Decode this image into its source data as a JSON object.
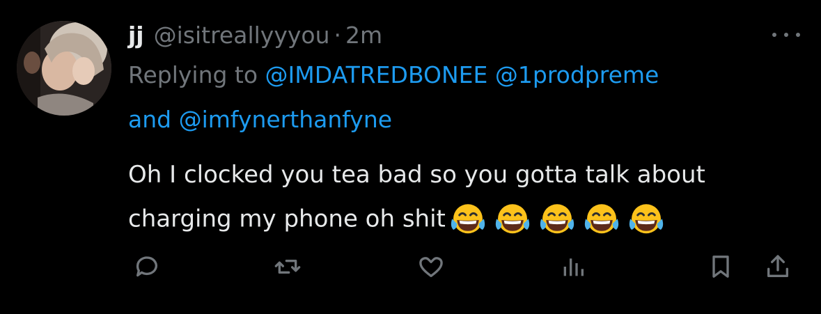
{
  "tweet": {
    "display_name": "jj",
    "handle": "@isitreallyyyou",
    "separator": "·",
    "time": "2m",
    "replying_prefix": "Replying to",
    "mentions": [
      "@IMDATREDBONEE",
      "@1prodpreme",
      "@imfynerthanfyne"
    ],
    "mention_joiner": "and",
    "text_line1": "Oh I clocked you tea bad so you gotta talk about",
    "text_line2": "charging my phone oh shit",
    "emoji_count": 5,
    "emoji_name": "face-with-tears-of-joy"
  },
  "actions": {
    "reply_icon": "reply-icon",
    "retweet_icon": "retweet-icon",
    "like_icon": "like-icon",
    "views_icon": "views-icon",
    "bookmark_icon": "bookmark-icon",
    "share_icon": "share-icon"
  },
  "colors": {
    "background": "#000000",
    "text": "#e7e9ea",
    "muted": "#71767b",
    "link": "#1d9bf0"
  }
}
